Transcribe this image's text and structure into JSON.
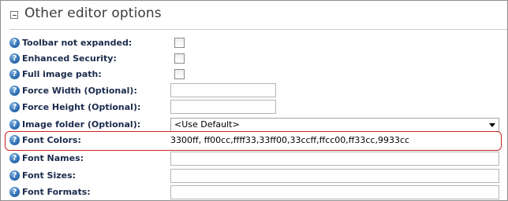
{
  "section": {
    "title": "Other editor options",
    "collapse_icon": "minus-box-icon"
  },
  "help_icon_glyph": "?",
  "rows": {
    "toolbar": {
      "label": "Toolbar not expanded:",
      "checked": false
    },
    "security": {
      "label": "Enhanced Security:",
      "checked": false
    },
    "fullpath": {
      "label": "Full image path:",
      "checked": false
    },
    "width": {
      "label": "Force Width (Optional):",
      "value": ""
    },
    "height": {
      "label": "Force Height (Optional):",
      "value": ""
    },
    "imagefolder": {
      "label": "Image folder (Optional):",
      "selected": "<Use Default>"
    },
    "colors": {
      "label": "Font Colors:",
      "value": "3300ff, ff00cc,ffff33,33ff00,33ccff,ffcc00,ff33cc,9933cc"
    },
    "names": {
      "label": "Font Names:",
      "value": ""
    },
    "sizes": {
      "label": "Font Sizes:",
      "value": ""
    },
    "formats": {
      "label": "Font Formats:",
      "value": ""
    }
  },
  "colors": {
    "highlight_border": "#cc2222",
    "label_text": "#1a2b4c",
    "help_icon": "#2f6fb3"
  }
}
